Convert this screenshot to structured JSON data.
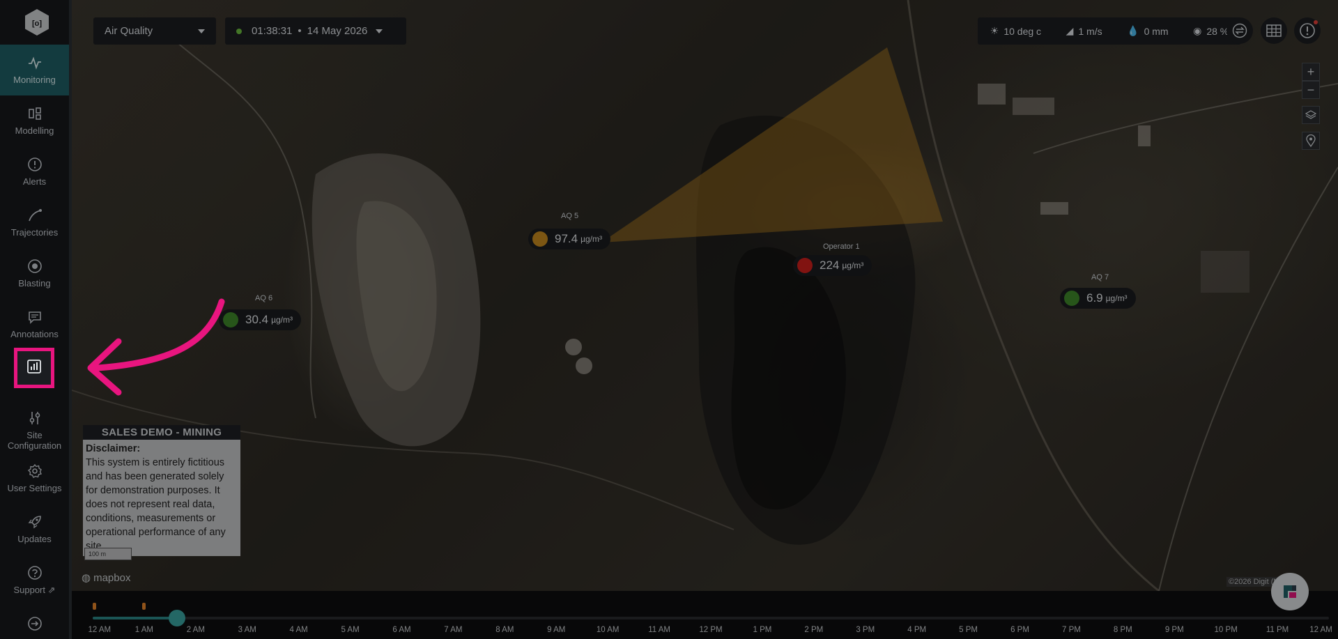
{
  "sidebar": {
    "logo_icon": "hexagon-logo-icon",
    "items": [
      {
        "label": "Monitoring",
        "icon": "pulse-icon"
      },
      {
        "label": "Modelling",
        "icon": "modelling-icon"
      },
      {
        "label": "Alerts",
        "icon": "alert-circle-icon"
      },
      {
        "label": "Trajectories",
        "icon": "trajectory-icon"
      },
      {
        "label": "Blasting",
        "icon": "target-icon"
      },
      {
        "label": "Annotations",
        "icon": "comment-icon"
      },
      {
        "label": "",
        "icon": "bar-chart-icon"
      },
      {
        "label": "Site Configuration",
        "icon": "sliders-icon"
      },
      {
        "label": "User Settings",
        "icon": "gear-icon"
      },
      {
        "label": "Updates",
        "icon": "rocket-icon"
      },
      {
        "label": "Support",
        "icon": "external-link-icon"
      }
    ]
  },
  "topbar": {
    "layer_select": "Air Quality",
    "time": "01:38:31",
    "separator": "•",
    "date": "14 May 2026",
    "weather": {
      "temp": "10 deg c",
      "wind": "1 m/s",
      "rain": "0 mm",
      "humidity": "28 %"
    }
  },
  "sensors": [
    {
      "name": "AQ 5",
      "value": "97.4",
      "unit": "µg/m³",
      "color": "#c98b1f"
    },
    {
      "name": "Operator 1",
      "value": "224",
      "unit": "µg/m³",
      "color": "#d0201c"
    },
    {
      "name": "AQ 6",
      "value": "30.4",
      "unit": "µg/m³",
      "color": "#3f8a2b"
    },
    {
      "name": "AQ 7",
      "value": "6.9",
      "unit": "µg/m³",
      "color": "#3f8a2b"
    }
  ],
  "disclaimer": {
    "header": "SALES DEMO - MINING",
    "title": "Disclaimer:",
    "text": "This system is entirely fictitious and has been generated solely for demonstration purposes. It does not represent real data, conditions, measurements or operational performance of any site."
  },
  "scale_label": "100 m",
  "mapbox_label": "mapbox",
  "attribution": "©2026 Digit  (Maxar)",
  "timeline": {
    "hours": [
      "12 AM",
      "1 AM",
      "2 AM",
      "3 AM",
      "4 AM",
      "5 AM",
      "6 AM",
      "7 AM",
      "8 AM",
      "9 AM",
      "10 AM",
      "11 AM",
      "12 PM",
      "1 PM",
      "2 PM",
      "3 PM",
      "4 PM",
      "5 PM",
      "6 PM",
      "7 PM",
      "8 PM",
      "9 PM",
      "10 PM",
      "11 PM",
      "12 AM"
    ],
    "position_fraction": 0.068
  },
  "colors": {
    "accent": "#1f5f66",
    "highlight": "#e8157f",
    "plume": "#c98b1f"
  }
}
